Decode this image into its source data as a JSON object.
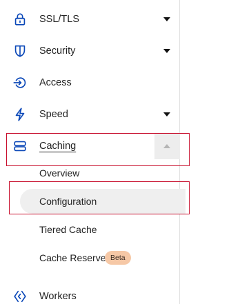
{
  "sidebar": {
    "items": [
      {
        "label": "SSL/TLS",
        "icon": "lock-icon",
        "expandable": true
      },
      {
        "label": "Security",
        "icon": "shield-icon",
        "expandable": true
      },
      {
        "label": "Access",
        "icon": "access-icon",
        "expandable": false
      },
      {
        "label": "Speed",
        "icon": "lightning-icon",
        "expandable": true
      },
      {
        "label": "Caching",
        "icon": "server-stack-icon",
        "expandable": true,
        "expanded": true
      },
      {
        "label": "Workers",
        "icon": "workers-icon",
        "expandable": false
      }
    ],
    "caching_subitems": [
      {
        "label": "Overview"
      },
      {
        "label": "Configuration",
        "active": true
      },
      {
        "label": "Tiered Cache"
      },
      {
        "label": "Cache Reserve",
        "badge": "Beta"
      }
    ]
  },
  "colors": {
    "accent_icon": "#0b48b8",
    "active_background": "#efefef",
    "beta_badge_background": "#f6c8a6",
    "highlight_outline": "#c8102e"
  }
}
